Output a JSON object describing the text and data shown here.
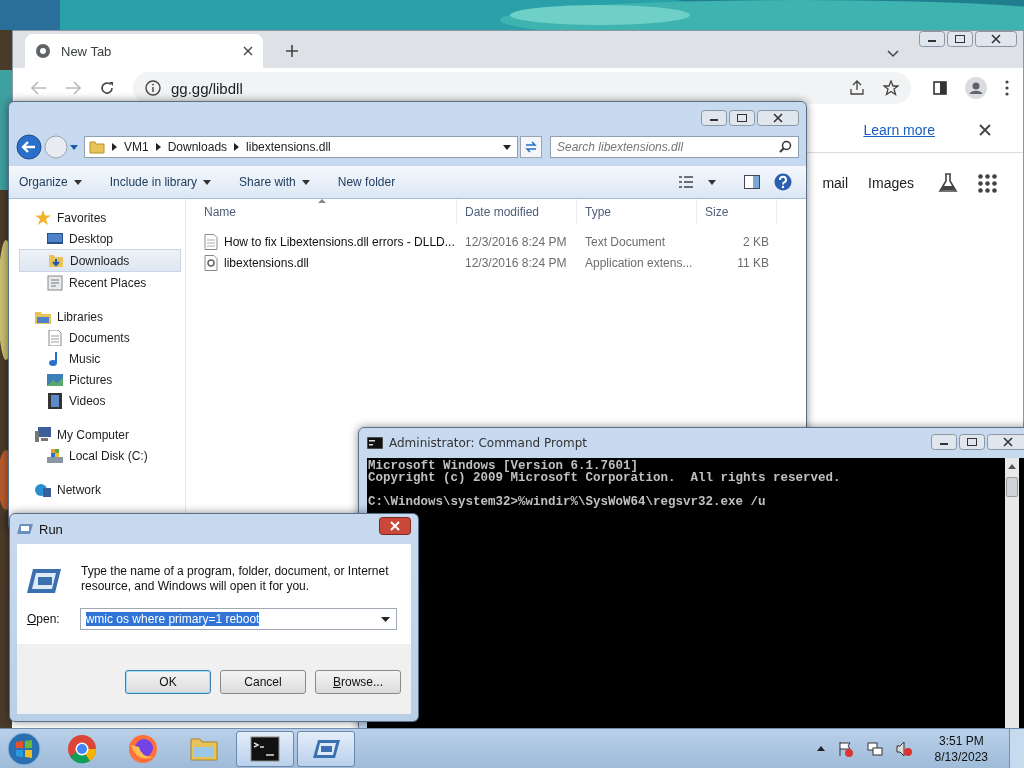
{
  "browser": {
    "tabs": [
      {
        "title": "New Tab",
        "selected": true
      }
    ],
    "url": "gg.gg/libdll",
    "notice_link": "Learn more",
    "links": [
      "mail",
      "Images"
    ]
  },
  "explorer": {
    "breadcrumb": [
      "VM1",
      "Downloads",
      "libextensions.dll"
    ],
    "search": {
      "placeholder": "Search libextensions.dll"
    },
    "toolbar": [
      {
        "label": "Organize",
        "has_menu": true
      },
      {
        "label": "Include in library",
        "has_menu": true
      },
      {
        "label": "Share with",
        "has_menu": true
      },
      {
        "label": "New folder",
        "has_menu": false
      }
    ],
    "sidebar": [
      {
        "label": "Favorites",
        "kind": "favorites",
        "selected": false,
        "children": [
          {
            "label": "Desktop",
            "kind": "desktop",
            "selected": false
          },
          {
            "label": "Downloads",
            "kind": "downloads",
            "selected": true
          },
          {
            "label": "Recent Places",
            "kind": "recent",
            "selected": false
          }
        ]
      },
      {
        "label": "Libraries",
        "kind": "libraries",
        "selected": false,
        "children": [
          {
            "label": "Documents",
            "kind": "documents",
            "selected": false
          },
          {
            "label": "Music",
            "kind": "music",
            "selected": false
          },
          {
            "label": "Pictures",
            "kind": "pictures",
            "selected": false
          },
          {
            "label": "Videos",
            "kind": "videos",
            "selected": false
          }
        ]
      },
      {
        "label": "My Computer",
        "kind": "computer",
        "selected": false,
        "children": [
          {
            "label": "Local Disk (C:)",
            "kind": "disk",
            "selected": false
          }
        ]
      },
      {
        "label": "Network",
        "kind": "network",
        "selected": false
      }
    ],
    "columns": [
      {
        "label": "Name",
        "sorted": true
      },
      {
        "label": "Date modified",
        "sorted": false
      },
      {
        "label": "Type",
        "sorted": false
      },
      {
        "label": "Size",
        "sorted": false
      }
    ],
    "files": [
      {
        "kind": "text",
        "name": "How to fix Libextensions.dll errors - DLLD...",
        "date": "12/3/2016 8:24 PM",
        "type": "Text Document",
        "size": "2 KB"
      },
      {
        "kind": "dll",
        "name": "libextensions.dll",
        "date": "12/3/2016 8:24 PM",
        "type": "Application extens...",
        "size": "11 KB"
      }
    ]
  },
  "cmd": {
    "title": "Administrator:  Command Prompt",
    "lines": [
      "Microsoft Windows [Version 6.1.7601]",
      "Copyright (c) 2009 Microsoft Corporation.  All rights reserved."
    ],
    "prompt": "C:\\Windows\\system32>%windir%\\SysWoW64\\regsvr32.exe /u"
  },
  "run": {
    "title": "Run",
    "description": "Type the name of a program, folder, document, or Internet resource, and Windows will open it for you.",
    "open_label": "Open:",
    "value": "wmic os where primary=1 reboot",
    "value_selected": true,
    "buttons": [
      {
        "label": "OK",
        "default": true,
        "underline_first": false
      },
      {
        "label": "Cancel",
        "default": false,
        "underline_first": false
      },
      {
        "label": "Browse...",
        "default": false,
        "underline_first": true
      }
    ]
  },
  "taskbar": {
    "items": [
      {
        "kind": "chrome",
        "active": false
      },
      {
        "kind": "firefox",
        "active": false
      },
      {
        "kind": "explorer",
        "active": false
      },
      {
        "kind": "cmd",
        "active": true
      },
      {
        "kind": "run",
        "active": true
      }
    ],
    "time": "3:51 PM",
    "date": "8/13/2023"
  }
}
